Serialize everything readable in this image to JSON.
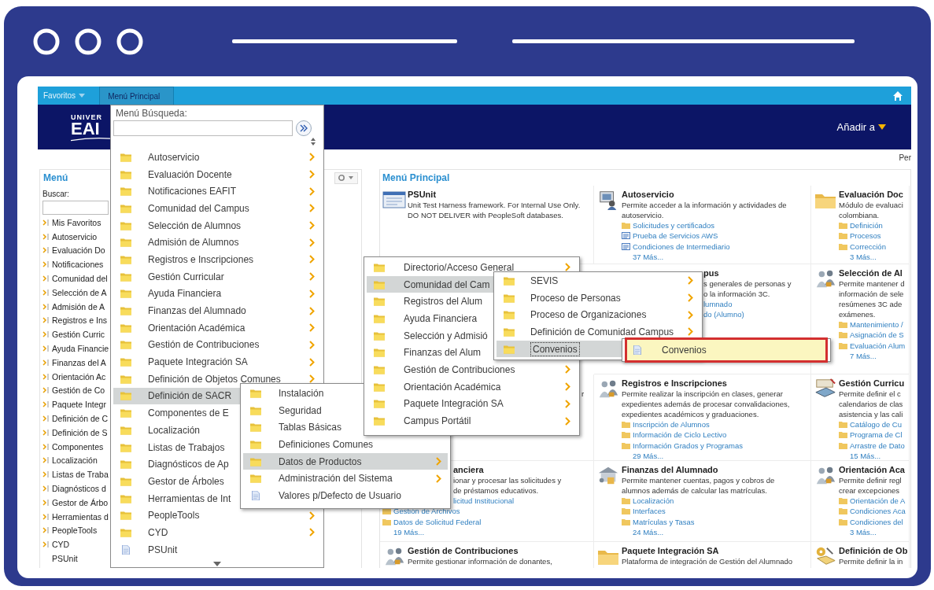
{
  "nav": {
    "favorites": "Favoritos",
    "tab": "Menú Principal"
  },
  "banner": {
    "logo_top": "UNIVER",
    "logo_main": "EAI",
    "add_to": "Añadir a"
  },
  "strip_text": "Per",
  "sidebar": {
    "title": "Menú",
    "search_label": "Buscar:",
    "items": [
      {
        "label": "Mis Favoritos",
        "kind": "folder"
      },
      {
        "label": "Autoservicio",
        "kind": "folder"
      },
      {
        "label": "Evaluación Do",
        "kind": "folder"
      },
      {
        "label": "Notificaciones",
        "kind": "folder"
      },
      {
        "label": "Comunidad del",
        "kind": "folder"
      },
      {
        "label": "Selección de A",
        "kind": "folder"
      },
      {
        "label": "Admisión de A",
        "kind": "folder"
      },
      {
        "label": "Registros e Ins",
        "kind": "folder"
      },
      {
        "label": "Gestión Curric",
        "kind": "folder"
      },
      {
        "label": "Ayuda Financie",
        "kind": "folder"
      },
      {
        "label": "Finanzas del A",
        "kind": "folder"
      },
      {
        "label": "Orientación Ac",
        "kind": "folder"
      },
      {
        "label": "Gestión de Co",
        "kind": "folder"
      },
      {
        "label": "Paquete Integr",
        "kind": "folder"
      },
      {
        "label": "Definición de C",
        "kind": "folder"
      },
      {
        "label": "Definición de S",
        "kind": "folder"
      },
      {
        "label": "Componentes",
        "kind": "folder"
      },
      {
        "label": "Localización",
        "kind": "folder"
      },
      {
        "label": "Listas de Traba",
        "kind": "folder"
      },
      {
        "label": "Diagnósticos d",
        "kind": "folder"
      },
      {
        "label": "Gestor de Árbo",
        "kind": "folder"
      },
      {
        "label": "Herramientas d",
        "kind": "folder"
      },
      {
        "label": "PeopleTools",
        "kind": "folder"
      },
      {
        "label": "CYD",
        "kind": "folder"
      },
      {
        "label": "PSUnit",
        "kind": "page"
      }
    ]
  },
  "main_menu": {
    "title": "Menú Principal",
    "tiles": [
      {
        "title": "PSUnit",
        "desc_lines": [
          "Unit Test Harness framework. For Internal Use Only.",
          "DO NOT DELIVER with PeopleSoft databases."
        ]
      },
      {
        "title": "Autoservicio",
        "desc_lines": [
          "Permite acceder a la información y actividades de",
          "autoservicio."
        ],
        "links": [
          {
            "kind": "folder",
            "text": "Solicitudes y certificados"
          },
          {
            "kind": "page",
            "text": "Prueba de Servicios AWS"
          },
          {
            "kind": "page",
            "text": "Condiciones de Intermediario"
          }
        ],
        "more": "37 Más..."
      },
      {
        "title": "Evaluación Doc",
        "desc_lines": [
          "Módulo de evaluaci",
          "colombiana."
        ],
        "links": [
          {
            "kind": "folder",
            "text": "Definición"
          },
          {
            "kind": "folder",
            "text": "Procesos"
          },
          {
            "kind": "folder",
            "text": "Corrección"
          }
        ],
        "more": "3 Más..."
      },
      {
        "title": "pus",
        "desc_lines": [
          "s generales de personas y",
          "o la información 3C."
        ],
        "links": [
          {
            "kind": "plain",
            "text": "lumnado"
          },
          {
            "kind": "plain",
            "text": "do (Alumno)"
          }
        ]
      },
      {
        "title": "Selección de Al",
        "desc_lines": [
          "Permite mantener d",
          "información de sele",
          "resúmenes 3C ade",
          "exámenes."
        ],
        "links": [
          {
            "kind": "folder",
            "text": "Mantenimiento /"
          },
          {
            "kind": "folder",
            "text": "Asignación de S"
          },
          {
            "kind": "folder",
            "text": "Evaluación Alum"
          }
        ],
        "more": "7 Más..."
      },
      {
        "desc_lines": [
          "r"
        ]
      },
      {
        "title": "Registros e Inscripciones",
        "desc_lines": [
          "Permite realizar la inscripción en clases, generar",
          "expedientes además de procesar convalidaciones,",
          "expedientes académicos y graduaciones."
        ],
        "links": [
          {
            "kind": "folder",
            "text": "Inscripción de Alumnos"
          },
          {
            "kind": "folder",
            "text": "Información de Ciclo Lectivo"
          },
          {
            "kind": "folder",
            "text": "Información Grados y Programas"
          }
        ],
        "more": "29 Más..."
      },
      {
        "title": "Gestión Curricu",
        "desc_lines": [
          "Permite definir el c",
          "calendarios de clas",
          "asistencia y las cali"
        ],
        "links": [
          {
            "kind": "folder",
            "text": "Catálogo de Cu"
          },
          {
            "kind": "folder",
            "text": "Programa de Cl"
          },
          {
            "kind": "folder",
            "text": "Arrastre de Dato"
          }
        ],
        "more": "15 Más..."
      },
      {
        "title": "anciera",
        "desc_lines": [
          "ionar y procesar las solicitudes y",
          "de préstamos educativos."
        ],
        "links": [
          {
            "kind": "plain",
            "text": "licitud Institucional"
          },
          {
            "kind": "folder",
            "text": "Gestión de Archivos"
          },
          {
            "kind": "folder",
            "text": "Datos de Solicitud Federal"
          }
        ],
        "more": "19 Más..."
      },
      {
        "title": "Finanzas del Alumnado",
        "desc_lines": [
          "Permite mantener cuentas, pagos y cobros de",
          "alumnos además de calcular las matrículas."
        ],
        "links": [
          {
            "kind": "folder",
            "text": "Localización"
          },
          {
            "kind": "folder",
            "text": "Interfaces"
          },
          {
            "kind": "folder",
            "text": "Matrículas y Tasas"
          }
        ],
        "more": "24 Más..."
      },
      {
        "title": "Orientación Aca",
        "desc_lines": [
          "Permite definir regl",
          "crear excepciones"
        ],
        "links": [
          {
            "kind": "folder",
            "text": "Orientación de A"
          },
          {
            "kind": "folder",
            "text": "Condiciones Aca"
          },
          {
            "kind": "folder",
            "text": "Condiciones del"
          }
        ],
        "more": "3 Más..."
      },
      {
        "title": "Gestión de Contribuciones",
        "desc_lines": [
          "Permite gestionar información de donantes,"
        ]
      },
      {
        "title": "Paquete Integración SA",
        "desc_lines": [
          "Plataforma de integración de Gestión del Alumnado"
        ]
      },
      {
        "title": "Definición de Ob",
        "desc_lines": [
          "Permite definir la in"
        ]
      }
    ]
  },
  "dropdown": {
    "search_label": "Menú Búsqueda:",
    "items": [
      {
        "label": "Autoservicio",
        "kind": "folder",
        "selected": false
      },
      {
        "label": "Evaluación Docente",
        "kind": "folder",
        "selected": false
      },
      {
        "label": "Notificaciones EAFIT",
        "kind": "folder",
        "selected": false
      },
      {
        "label": "Comunidad del Campus",
        "kind": "folder",
        "selected": false
      },
      {
        "label": "Selección de Alumnos",
        "kind": "folder",
        "selected": false
      },
      {
        "label": "Admisión de Alumnos",
        "kind": "folder",
        "selected": false
      },
      {
        "label": "Registros e Inscripciones",
        "kind": "folder",
        "selected": false
      },
      {
        "label": "Gestión Curricular",
        "kind": "folder",
        "selected": false
      },
      {
        "label": "Ayuda Financiera",
        "kind": "folder",
        "selected": false
      },
      {
        "label": "Finanzas del Alumnado",
        "kind": "folder",
        "selected": false
      },
      {
        "label": "Orientación Académica",
        "kind": "folder",
        "selected": false
      },
      {
        "label": "Gestión de Contribuciones",
        "kind": "folder",
        "selected": false
      },
      {
        "label": "Paquete Integración SA",
        "kind": "folder",
        "selected": false
      },
      {
        "label": "Definición de Objetos Comunes",
        "kind": "folder",
        "selected": false
      },
      {
        "label": "Definición de SACR",
        "kind": "folder",
        "selected": true
      },
      {
        "label": "Componentes de E",
        "kind": "folder",
        "selected": false
      },
      {
        "label": "Localización",
        "kind": "folder",
        "selected": false
      },
      {
        "label": "Listas de Trabajos",
        "kind": "folder",
        "selected": false
      },
      {
        "label": "Diagnósticos de Ap",
        "kind": "folder",
        "selected": false
      },
      {
        "label": "Gestor de Árboles",
        "kind": "folder",
        "selected": false
      },
      {
        "label": "Herramientas de Int",
        "kind": "folder",
        "selected": false
      },
      {
        "label": "PeopleTools",
        "kind": "folder",
        "selected": false
      },
      {
        "label": "CYD",
        "kind": "folder",
        "selected": false
      },
      {
        "label": "PSUnit",
        "kind": "page",
        "selected": false
      }
    ]
  },
  "submenus": [
    {
      "items": [
        {
          "label": "Instalación",
          "kind": "folder",
          "selected": false
        },
        {
          "label": "Seguridad",
          "kind": "folder",
          "selected": false
        },
        {
          "label": "Tablas Básicas",
          "kind": "folder",
          "selected": false
        },
        {
          "label": "Definiciones Comunes",
          "kind": "folder",
          "selected": false
        },
        {
          "label": "Datos de Productos",
          "kind": "folder",
          "selected": true
        },
        {
          "label": "Administración del Sistema",
          "kind": "folder",
          "selected": false
        },
        {
          "label": "Valores p/Defecto de Usuario",
          "kind": "page",
          "selected": false
        }
      ]
    },
    {
      "items": [
        {
          "label": "Directorio/Acceso General",
          "kind": "folder",
          "selected": false
        },
        {
          "label": "Comunidad del Cam",
          "kind": "folder",
          "selected": true
        },
        {
          "label": "Registros del Alum",
          "kind": "folder",
          "selected": false
        },
        {
          "label": "Ayuda Financiera",
          "kind": "folder",
          "selected": false
        },
        {
          "label": "Selección y Admisió",
          "kind": "folder",
          "selected": false
        },
        {
          "label": "Finanzas del Alum",
          "kind": "folder",
          "selected": false
        },
        {
          "label": "Gestión de Contribuciones",
          "kind": "folder",
          "selected": false
        },
        {
          "label": "Orientación Académica",
          "kind": "folder",
          "selected": false
        },
        {
          "label": "Paquete Integración SA",
          "kind": "folder",
          "selected": false
        },
        {
          "label": "Campus Portátil",
          "kind": "folder",
          "selected": false
        }
      ]
    },
    {
      "items": [
        {
          "label": "SEVIS",
          "kind": "folder",
          "selected": false
        },
        {
          "label": "Proceso de Personas",
          "kind": "folder",
          "selected": false
        },
        {
          "label": "Proceso de Organizaciones",
          "kind": "folder",
          "selected": false
        },
        {
          "label": "Definición de Comunidad Campus",
          "kind": "folder",
          "selected": false
        },
        {
          "label": "Convenios",
          "kind": "folder",
          "selected": true
        }
      ]
    },
    {
      "items": [
        {
          "label": "Convenios",
          "kind": "page",
          "highlighted": true
        }
      ]
    }
  ]
}
